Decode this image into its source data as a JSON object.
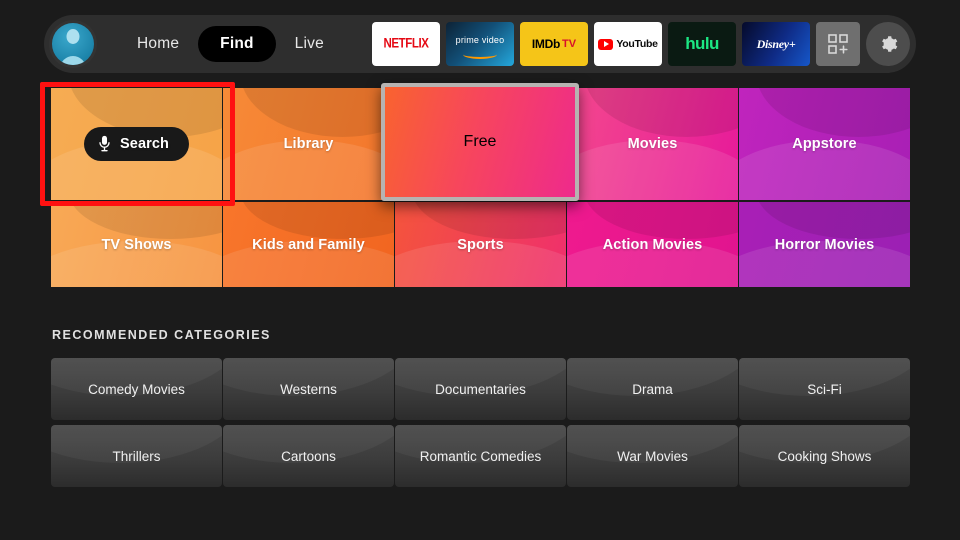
{
  "header": {
    "avatar_name": "profile-avatar",
    "nav": [
      {
        "label": "Home",
        "active": false
      },
      {
        "label": "Find",
        "active": true
      },
      {
        "label": "Live",
        "active": false
      }
    ],
    "apps": [
      {
        "name": "netflix",
        "label": "NETFLIX"
      },
      {
        "name": "prime-video",
        "label": "prime video"
      },
      {
        "name": "imdb-tv",
        "label": "IMDb",
        "suffix": "TV"
      },
      {
        "name": "youtube",
        "label": "YouTube"
      },
      {
        "name": "hulu",
        "label": "hulu"
      },
      {
        "name": "disney-plus",
        "label": "Disney+"
      },
      {
        "name": "all-apps",
        "label": ""
      },
      {
        "name": "settings",
        "label": ""
      }
    ]
  },
  "categories": {
    "row1": [
      {
        "label": "Search",
        "color_a": "#f6ac53",
        "color_b": "#f6a347",
        "is_search": true,
        "focused_red": true
      },
      {
        "label": "Library",
        "color_a": "#f68a37",
        "color_b": "#f4762c",
        "is_search": false,
        "focused_red": false
      },
      {
        "label": "Free",
        "color_a": "#f9632f",
        "color_b": "#ee2a8c",
        "is_search": false,
        "focused_gray": true
      },
      {
        "label": "Movies",
        "color_a": "#f4498d",
        "color_b": "#e6199a",
        "is_search": false
      },
      {
        "label": "Appstore",
        "color_a": "#c024bd",
        "color_b": "#a81fb5",
        "is_search": false
      }
    ],
    "row2": [
      {
        "label": "TV Shows",
        "color_a": "#f8a956",
        "color_b": "#f79441"
      },
      {
        "label": "Kids and Family",
        "color_a": "#f8762b",
        "color_b": "#f16520"
      },
      {
        "label": "Sports",
        "color_a": "#f4543c",
        "color_b": "#ef2f6d"
      },
      {
        "label": "Action Movies",
        "color_a": "#ef1a8e",
        "color_b": "#e1148f"
      },
      {
        "label": "Horror Movies",
        "color_a": "#a91fb6",
        "color_b": "#9b20b4"
      }
    ]
  },
  "recommended": {
    "heading": "RECOMMENDED CATEGORIES",
    "row1": [
      "Comedy Movies",
      "Westerns",
      "Documentaries",
      "Drama",
      "Sci-Fi"
    ],
    "row2": [
      "Thrillers",
      "Cartoons",
      "Romantic Comedies",
      "War Movies",
      "Cooking Shows"
    ]
  },
  "colors": {
    "background": "#1b1b1b",
    "header_bar": "#2e2e2e",
    "focus_red": "#ff1111",
    "focus_gray": "#b6b3b1",
    "accent_pill": "#000000"
  }
}
